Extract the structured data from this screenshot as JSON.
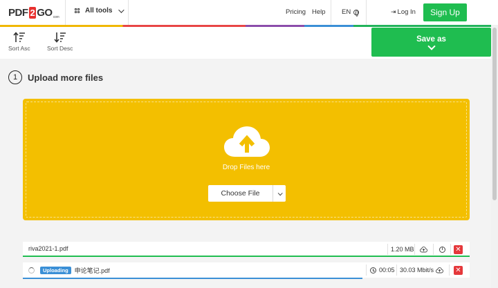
{
  "header": {
    "logo": {
      "prefix": "PDF",
      "two": "2",
      "suffix": "GO",
      "tm": "com"
    },
    "all_tools": "All tools",
    "pricing": "Pricing",
    "help": "Help",
    "lang": "EN",
    "login": "Log In",
    "signup": "Sign Up"
  },
  "toolbar": {
    "sort_asc": "Sort Asc",
    "sort_desc": "Sort Desc",
    "save_as": "Save as"
  },
  "upload": {
    "step_number": "1",
    "title": "Upload more files",
    "drop_text": "Drop Files here",
    "choose_file": "Choose File"
  },
  "files": [
    {
      "name": "riva2021-1.pdf",
      "size": "1.20 MB",
      "progress": 1.0
    },
    {
      "name": "申论笔记.pdf",
      "status": "Uploading",
      "time": "00:05",
      "speed": "30.03 Mbit/s",
      "progress": 0.76
    }
  ],
  "colors": {
    "accent_green": "#1fbd50",
    "dropzone_yellow": "#f3bf00",
    "uploading_blue": "#3a8fd6",
    "delete_red": "#e5383b"
  }
}
